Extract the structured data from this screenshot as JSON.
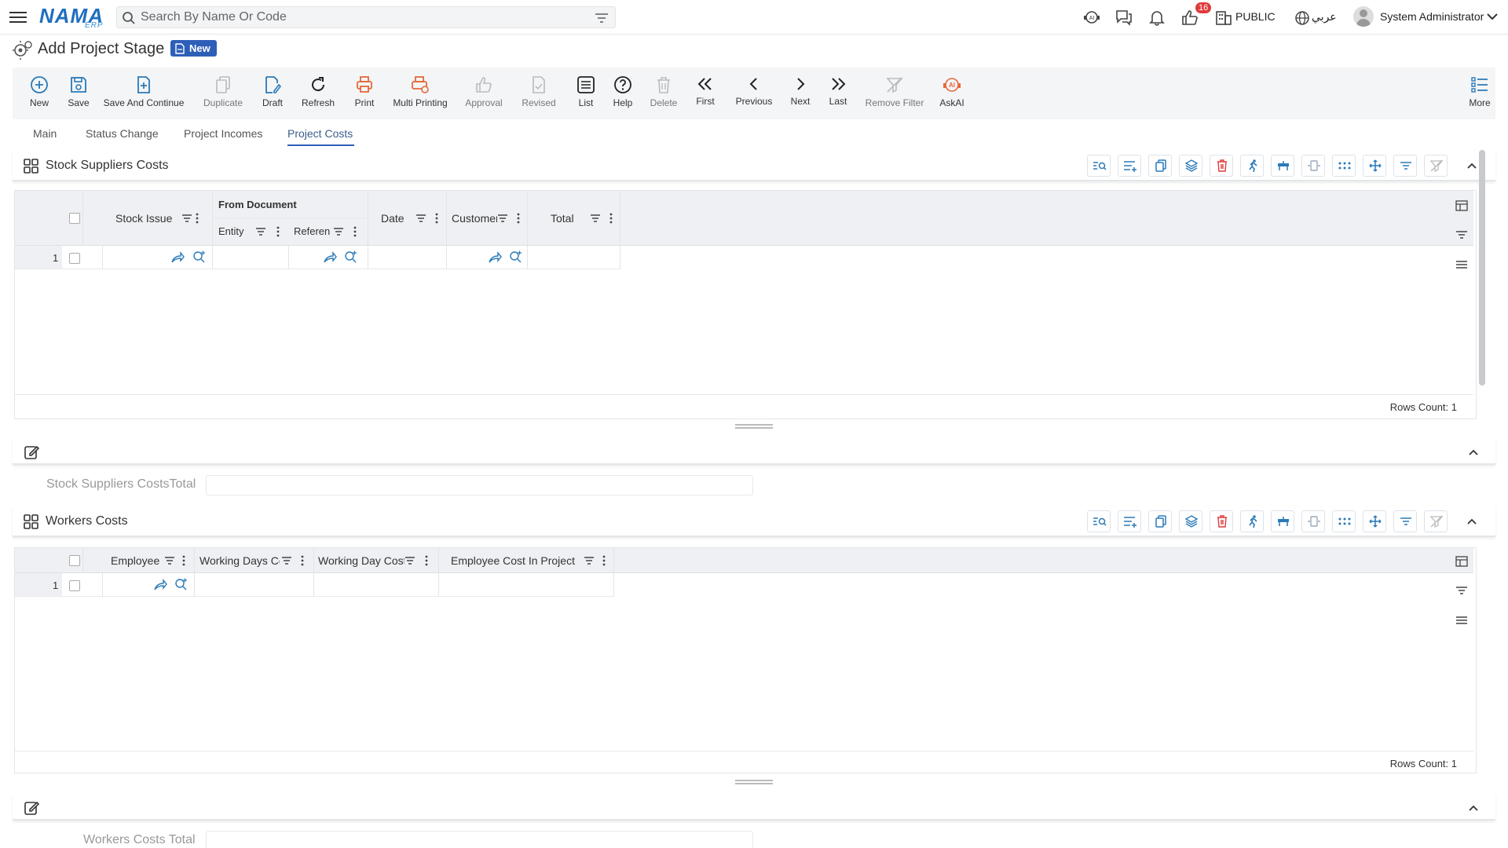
{
  "header": {
    "logo_text": "NAMA",
    "logo_sub": "ERP",
    "search_placeholder": "Search By Name Or Code",
    "notifications_count": "16",
    "branch": "PUBLIC",
    "language": "عربي",
    "user_name": "System Administrator"
  },
  "page": {
    "title": "Add Project Stage",
    "status_badge": "New"
  },
  "toolbar": {
    "items": [
      {
        "label": "New",
        "icon": "plus-circle-icon"
      },
      {
        "label": "Save",
        "icon": "save-icon"
      },
      {
        "label": "Save And Continue",
        "icon": "save-continue-icon"
      },
      {
        "label": "Duplicate",
        "icon": "duplicate-icon"
      },
      {
        "label": "Draft",
        "icon": "draft-icon"
      },
      {
        "label": "Refresh",
        "icon": "refresh-icon"
      },
      {
        "label": "Print",
        "icon": "print-icon"
      },
      {
        "label": "Multi Printing",
        "icon": "multi-print-icon"
      },
      {
        "label": "Approval",
        "icon": "thumbs-up-icon"
      },
      {
        "label": "Revised",
        "icon": "revised-icon"
      },
      {
        "label": "List",
        "icon": "list-icon"
      },
      {
        "label": "Help",
        "icon": "help-icon"
      },
      {
        "label": "Delete",
        "icon": "delete-icon"
      },
      {
        "label": "First",
        "icon": "first-icon"
      },
      {
        "label": "Previous",
        "icon": "previous-icon"
      },
      {
        "label": "Next",
        "icon": "next-icon"
      },
      {
        "label": "Last",
        "icon": "last-icon"
      },
      {
        "label": "Remove Filter",
        "icon": "remove-filter-icon"
      },
      {
        "label": "AskAI",
        "icon": "ai-icon"
      },
      {
        "label": "More",
        "icon": "more-icon"
      }
    ]
  },
  "tabs": [
    {
      "label": "Main"
    },
    {
      "label": "Status Change"
    },
    {
      "label": "Project Incomes"
    },
    {
      "label": "Project Costs",
      "active": true
    }
  ],
  "stock_section": {
    "title": "Stock Suppliers Costs",
    "columns": {
      "stock_issue": "Stock Issue",
      "from_document": "From Document",
      "entity_type": "Entity Ty",
      "reference": "Referen",
      "date": "Date",
      "customer": "Customer",
      "total": "Total"
    },
    "rows": [
      {
        "num": "1"
      }
    ],
    "rows_count": "Rows Count: 1",
    "total_label": "Stock Suppliers CostsTotal",
    "total_value": ""
  },
  "workers_section": {
    "title": "Workers Costs",
    "columns": {
      "employee": "Employee",
      "working_days": "Working Days Co",
      "working_day_cost": "Working Day Cost",
      "employee_cost": "Employee Cost In Project"
    },
    "rows": [
      {
        "num": "1"
      }
    ],
    "rows_count": "Rows Count: 1",
    "total_label": "Workers Costs Total",
    "total_value": ""
  },
  "colors": {
    "accent": "#2e5fb8",
    "icon_blue": "#2a7ab8",
    "icon_orange": "#e5683a",
    "danger": "#e03a3a",
    "grid_header": "#eef0f3"
  }
}
